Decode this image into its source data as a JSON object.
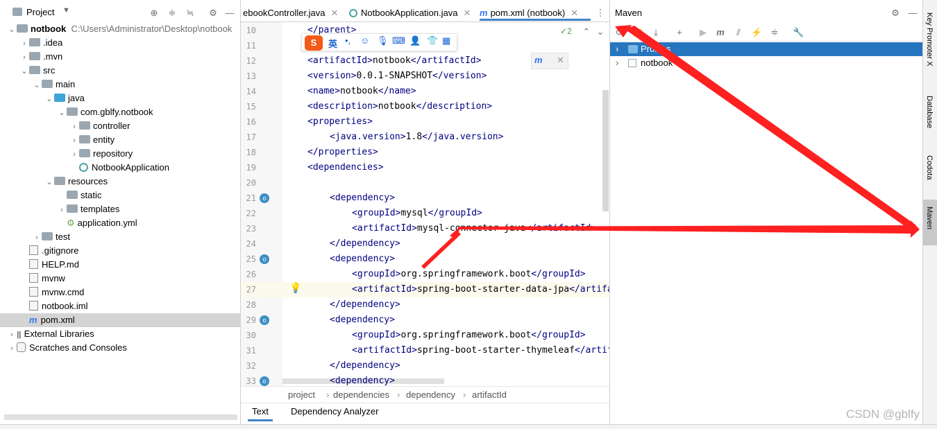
{
  "project_panel": {
    "title": "Project",
    "root": {
      "name": "notbook",
      "path": "C:\\Users\\Administrator\\Desktop\\notbook"
    },
    "items": [
      {
        "label": ".idea",
        "indent": 1,
        "type": "folder",
        "arrow": "›"
      },
      {
        "label": ".mvn",
        "indent": 1,
        "type": "folder",
        "arrow": "›"
      },
      {
        "label": "src",
        "indent": 1,
        "type": "folder",
        "arrow": "⌄"
      },
      {
        "label": "main",
        "indent": 2,
        "type": "folder",
        "arrow": "⌄"
      },
      {
        "label": "java",
        "indent": 3,
        "type": "folder-blue",
        "arrow": "⌄"
      },
      {
        "label": "com.gblfy.notbook",
        "indent": 4,
        "type": "package",
        "arrow": "⌄"
      },
      {
        "label": "controller",
        "indent": 5,
        "type": "package",
        "arrow": "›"
      },
      {
        "label": "entity",
        "indent": 5,
        "type": "package",
        "arrow": "›"
      },
      {
        "label": "repository",
        "indent": 5,
        "type": "package",
        "arrow": "›"
      },
      {
        "label": "NotbookApplication",
        "indent": 5,
        "type": "class",
        "arrow": ""
      },
      {
        "label": "resources",
        "indent": 3,
        "type": "folder",
        "arrow": "⌄"
      },
      {
        "label": "static",
        "indent": 4,
        "type": "folder",
        "arrow": ""
      },
      {
        "label": "templates",
        "indent": 4,
        "type": "folder",
        "arrow": "›"
      },
      {
        "label": "application.yml",
        "indent": 4,
        "type": "yml",
        "arrow": ""
      },
      {
        "label": "test",
        "indent": 2,
        "type": "folder",
        "arrow": "›"
      },
      {
        "label": ".gitignore",
        "indent": 1,
        "type": "file",
        "arrow": ""
      },
      {
        "label": "HELP.md",
        "indent": 1,
        "type": "file",
        "arrow": ""
      },
      {
        "label": "mvnw",
        "indent": 1,
        "type": "file",
        "arrow": ""
      },
      {
        "label": "mvnw.cmd",
        "indent": 1,
        "type": "file",
        "arrow": ""
      },
      {
        "label": "notbook.iml",
        "indent": 1,
        "type": "file",
        "arrow": ""
      },
      {
        "label": "pom.xml",
        "indent": 1,
        "type": "maven",
        "arrow": "",
        "selected": true
      },
      {
        "label": "External Libraries",
        "indent": 0,
        "type": "libs",
        "arrow": "›"
      },
      {
        "label": "Scratches and Consoles",
        "indent": 0,
        "type": "scratch",
        "arrow": "›"
      }
    ]
  },
  "editor": {
    "tabs": [
      {
        "label": "ebookController.java",
        "active": false
      },
      {
        "label": "NotbookApplication.java",
        "active": false
      },
      {
        "label": "pom.xml (notbook)",
        "active": true
      }
    ],
    "inspection_count": "2",
    "lines": [
      {
        "n": "10",
        "indent": 0,
        "text": "</parent>"
      },
      {
        "n": "11",
        "indent": 0,
        "text": ""
      },
      {
        "n": "12",
        "indent": 0,
        "text": "<artifactId>notbook</artifactId>"
      },
      {
        "n": "13",
        "indent": 0,
        "text": "<version>0.0.1-SNAPSHOT</version>"
      },
      {
        "n": "14",
        "indent": 0,
        "text": "<name>notbook</name>"
      },
      {
        "n": "15",
        "indent": 0,
        "text": "<description>notbook</description>"
      },
      {
        "n": "16",
        "indent": 0,
        "text": "<properties>"
      },
      {
        "n": "17",
        "indent": 1,
        "text": "<java.version>1.8</java.version>"
      },
      {
        "n": "18",
        "indent": 0,
        "text": "</properties>"
      },
      {
        "n": "19",
        "indent": 0,
        "text": "<dependencies>"
      },
      {
        "n": "20",
        "indent": 0,
        "text": ""
      },
      {
        "n": "21",
        "indent": 1,
        "text": "<dependency>"
      },
      {
        "n": "22",
        "indent": 2,
        "text": "<groupId>mysql</groupId>"
      },
      {
        "n": "23",
        "indent": 2,
        "text": "<artifactId>mysql-connector-java</artifactId>"
      },
      {
        "n": "24",
        "indent": 1,
        "text": "</dependency>"
      },
      {
        "n": "25",
        "indent": 1,
        "text": "<dependency>"
      },
      {
        "n": "26",
        "indent": 2,
        "text": "<groupId>org.springframework.boot</groupId>"
      },
      {
        "n": "27",
        "indent": 2,
        "text": "<artifactId>spring-boot-starter-data-jpa</artifactId>"
      },
      {
        "n": "28",
        "indent": 1,
        "text": "</dependency>"
      },
      {
        "n": "29",
        "indent": 1,
        "text": "<dependency>"
      },
      {
        "n": "30",
        "indent": 2,
        "text": "<groupId>org.springframework.boot</groupId>"
      },
      {
        "n": "31",
        "indent": 2,
        "text": "<artifactId>spring-boot-starter-thymeleaf</artifactId>"
      },
      {
        "n": "32",
        "indent": 1,
        "text": "</dependency>"
      },
      {
        "n": "33",
        "indent": 1,
        "text": "<dependency>"
      }
    ],
    "breadcrumb": [
      "project",
      "dependencies",
      "dependency",
      "artifactId"
    ],
    "bottom_tabs": [
      "Text",
      "Dependency Analyzer"
    ],
    "ime_toolbar_char": "英"
  },
  "maven": {
    "title": "Maven",
    "items": [
      {
        "label": "Profiles",
        "selected": true
      },
      {
        "label": "notbook",
        "selected": false
      }
    ]
  },
  "right_bar": [
    "Key Promoter X",
    "Database",
    "Codota",
    "Maven"
  ],
  "watermark": "CSDN @gblfy",
  "colors": {
    "selection": "#2675bf",
    "tree_selected": "#d4d4d4",
    "arrow": "#ff2020",
    "tag": "#000080"
  }
}
